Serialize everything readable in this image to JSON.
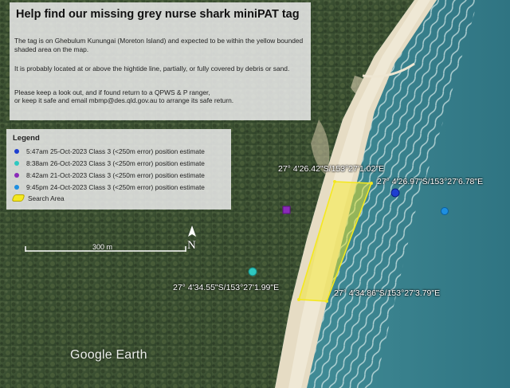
{
  "title": "Help find our missing grey nurse shark miniPAT tag",
  "paragraphs": [
    "The tag is on Ghebulum Kunungai (Moreton Island) and expected to be within the yellow bounded shaded area on the map.",
    "It is probably located at or above the hightide line, partially, or fully covered by debris or sand.",
    "Please keep a look out, and if found return to a QPWS & P ranger,",
    "or keep it safe and email mbmp@des.qld.gov.au to arrange its safe return."
  ],
  "legend": {
    "title": "Legend",
    "items": [
      {
        "label": "5:47am 25-Oct-2023 Class 3 (<250m error) position estimate",
        "color": "#1e3fd0"
      },
      {
        "label": "8:38am 26-Oct-2023 Class 3 (<250m error) position estimate",
        "color": "#2ec8c0"
      },
      {
        "label": "8:42am 21-Oct-2023 Class 3 (<250m error) position estimate",
        "color": "#8a2ab8"
      },
      {
        "label": "9:45pm 24-Oct-2023 Class 3 (<250m error) position estimate",
        "color": "#1e8fe0"
      },
      {
        "label": "Search Area",
        "color": "#f4e820"
      }
    ]
  },
  "coordinates": {
    "nw": "27° 4'26.42\"S/153°27'1.02\"E",
    "ne": "27° 4'26.97\"S/153°27'6.78\"E",
    "sw": "27° 4'34.55\"S/153°27'1.99\"E",
    "se": "27° 4'34.86\"S/153°27'3.79\"E"
  },
  "scale": "300 m",
  "north": "N",
  "watermark": "Google Earth"
}
